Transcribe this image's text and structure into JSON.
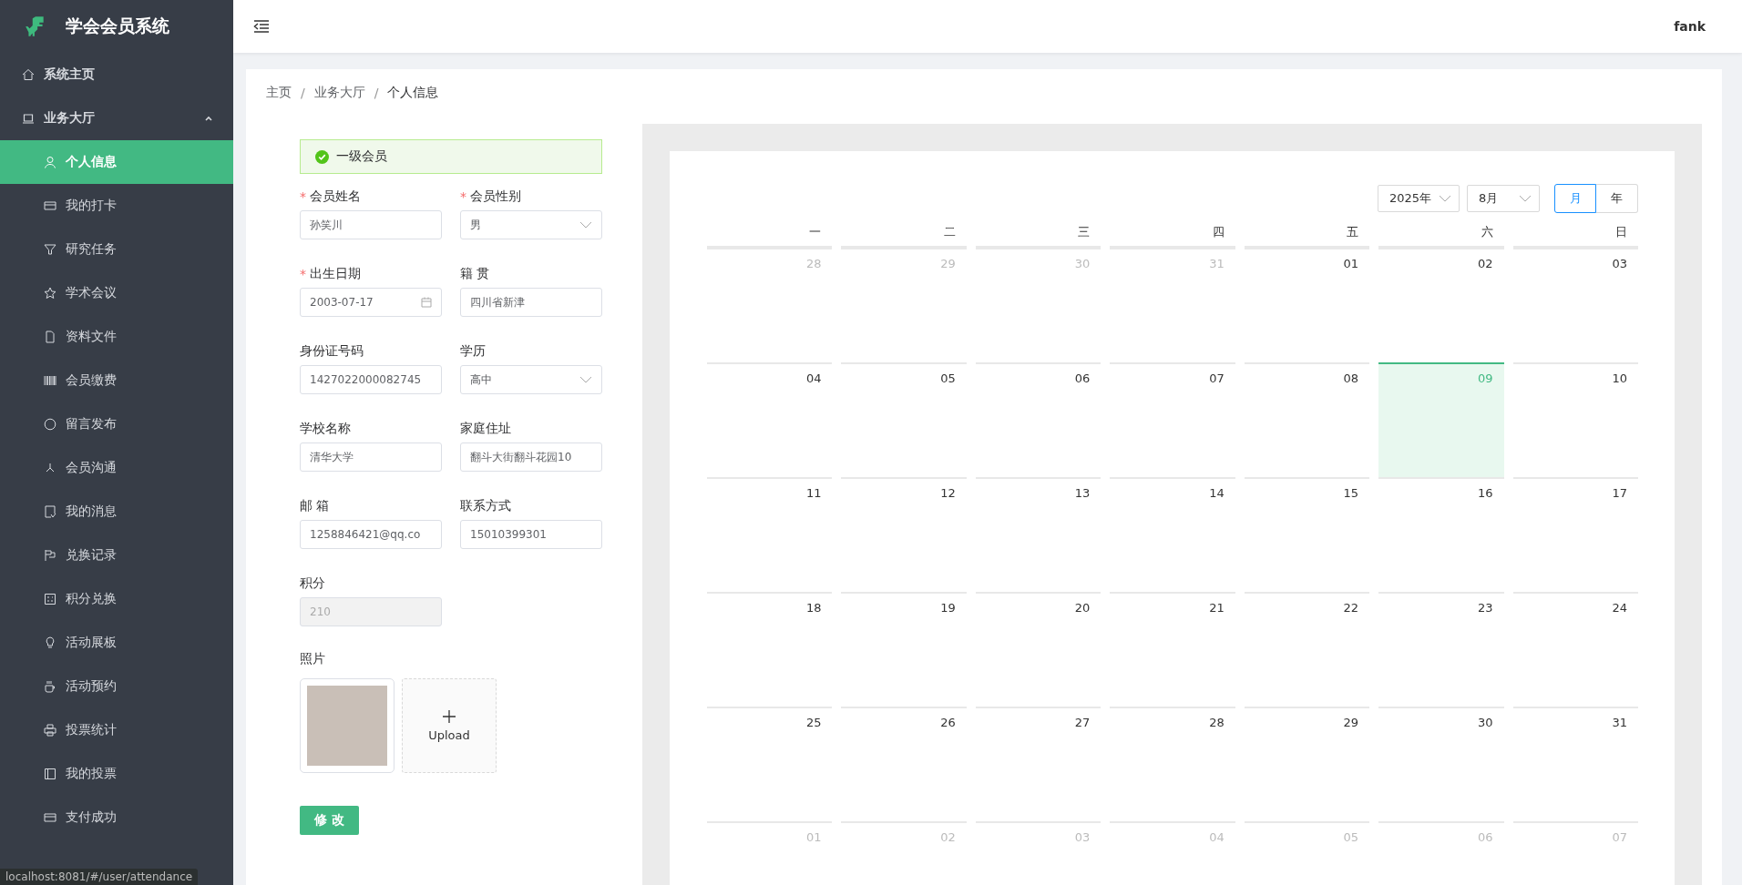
{
  "sidebar": {
    "title": "学会会员系统",
    "items": [
      {
        "label": "系统主页",
        "selected": false
      },
      {
        "label": "业务大厅",
        "expanded": true,
        "selected": false,
        "children": [
          {
            "label": "个人信息",
            "selected": true
          },
          {
            "label": "我的打卡",
            "selected": false
          },
          {
            "label": "研究任务",
            "selected": false
          },
          {
            "label": "学术会议",
            "selected": false
          },
          {
            "label": "资料文件",
            "selected": false
          },
          {
            "label": "会员缴费",
            "selected": false
          },
          {
            "label": "留言发布",
            "selected": false
          },
          {
            "label": "会员沟通",
            "selected": false
          },
          {
            "label": "我的消息",
            "selected": false
          },
          {
            "label": "兑换记录",
            "selected": false
          },
          {
            "label": "积分兑换",
            "selected": false
          },
          {
            "label": "活动展板",
            "selected": false
          },
          {
            "label": "活动预约",
            "selected": false
          },
          {
            "label": "投票统计",
            "selected": false
          },
          {
            "label": "我的投票",
            "selected": false
          },
          {
            "label": "支付成功",
            "selected": false
          }
        ]
      }
    ]
  },
  "header": {
    "user": "fank"
  },
  "breadcrumb": [
    {
      "kind": "link",
      "text": "主页"
    },
    {
      "kind": "separator",
      "text": "/"
    },
    {
      "kind": "link",
      "text": "业务大厅"
    },
    {
      "kind": "separator",
      "text": "/"
    },
    {
      "kind": "current",
      "text": "个人信息"
    }
  ],
  "member_level": "一级会员",
  "form": {
    "fields": [
      {
        "label": "会员姓名",
        "required_mark": "*",
        "kind": "text",
        "value": "孙笑川"
      },
      {
        "label": "会员性别",
        "required_mark": "*",
        "kind": "select",
        "value": "男"
      },
      {
        "label": "出生日期",
        "required_mark": "*",
        "kind": "date",
        "value": "2003-07-17"
      },
      {
        "label": "籍 贯",
        "kind": "text",
        "value": "四川省新津"
      },
      {
        "label": "身份证号码",
        "kind": "text",
        "value": "1427022000082745"
      },
      {
        "label": "学历",
        "kind": "select",
        "value": "高中"
      },
      {
        "label": "学校名称",
        "kind": "text",
        "value": "清华大学"
      },
      {
        "label": "家庭住址",
        "kind": "text",
        "value": "翻斗大街翻斗花园10"
      },
      {
        "label": "邮 箱",
        "kind": "text",
        "value": "1258846421@qq.co"
      },
      {
        "label": "联系方式",
        "kind": "text",
        "value": "15010399301"
      },
      {
        "label": "积分",
        "kind": "disabled",
        "value": "210"
      }
    ],
    "photo_label": "照片",
    "upload_label": "Upload",
    "submit": "修 改"
  },
  "calendar": {
    "year": "2025年",
    "month": "8月",
    "modes": [
      {
        "label": "月",
        "selected": true
      },
      {
        "label": "年",
        "selected": false
      }
    ],
    "weekdays": [
      "一",
      "二",
      "三",
      "四",
      "五",
      "六",
      "日"
    ],
    "weeks": [
      [
        {
          "label": "28",
          "kind": "prev",
          "selected": false
        },
        {
          "label": "29",
          "kind": "prev",
          "selected": false
        },
        {
          "label": "30",
          "kind": "prev",
          "selected": false
        },
        {
          "label": "31",
          "kind": "prev",
          "selected": false
        },
        {
          "label": "01",
          "kind": "current",
          "selected": false
        },
        {
          "label": "02",
          "kind": "current",
          "selected": false
        },
        {
          "label": "03",
          "kind": "current",
          "selected": false
        }
      ],
      [
        {
          "label": "04",
          "kind": "current",
          "selected": false
        },
        {
          "label": "05",
          "kind": "current",
          "selected": false
        },
        {
          "label": "06",
          "kind": "current",
          "selected": false
        },
        {
          "label": "07",
          "kind": "current",
          "selected": false
        },
        {
          "label": "08",
          "kind": "current",
          "selected": false
        },
        {
          "label": "09",
          "kind": "current",
          "selected": true
        },
        {
          "label": "10",
          "kind": "current",
          "selected": false
        }
      ],
      [
        {
          "label": "11",
          "kind": "current",
          "selected": false
        },
        {
          "label": "12",
          "kind": "current",
          "selected": false
        },
        {
          "label": "13",
          "kind": "current",
          "selected": false
        },
        {
          "label": "14",
          "kind": "current",
          "selected": false
        },
        {
          "label": "15",
          "kind": "current",
          "selected": false
        },
        {
          "label": "16",
          "kind": "current",
          "selected": false
        },
        {
          "label": "17",
          "kind": "current",
          "selected": false
        }
      ],
      [
        {
          "label": "18",
          "kind": "current",
          "selected": false
        },
        {
          "label": "19",
          "kind": "current",
          "selected": false
        },
        {
          "label": "20",
          "kind": "current",
          "selected": false
        },
        {
          "label": "21",
          "kind": "current",
          "selected": false
        },
        {
          "label": "22",
          "kind": "current",
          "selected": false
        },
        {
          "label": "23",
          "kind": "current",
          "selected": false
        },
        {
          "label": "24",
          "kind": "current",
          "selected": false
        }
      ],
      [
        {
          "label": "25",
          "kind": "current",
          "selected": false
        },
        {
          "label": "26",
          "kind": "current",
          "selected": false
        },
        {
          "label": "27",
          "kind": "current",
          "selected": false
        },
        {
          "label": "28",
          "kind": "current",
          "selected": false
        },
        {
          "label": "29",
          "kind": "current",
          "selected": false
        },
        {
          "label": "30",
          "kind": "current",
          "selected": false
        },
        {
          "label": "31",
          "kind": "current",
          "selected": false
        }
      ],
      [
        {
          "label": "01",
          "kind": "next",
          "selected": false
        },
        {
          "label": "02",
          "kind": "next",
          "selected": false
        },
        {
          "label": "03",
          "kind": "next",
          "selected": false
        },
        {
          "label": "04",
          "kind": "next",
          "selected": false
        },
        {
          "label": "05",
          "kind": "next",
          "selected": false
        },
        {
          "label": "06",
          "kind": "next",
          "selected": false
        },
        {
          "label": "07",
          "kind": "next",
          "selected": false
        }
      ]
    ]
  },
  "status_url": "localhost:8081/#/user/attendance"
}
